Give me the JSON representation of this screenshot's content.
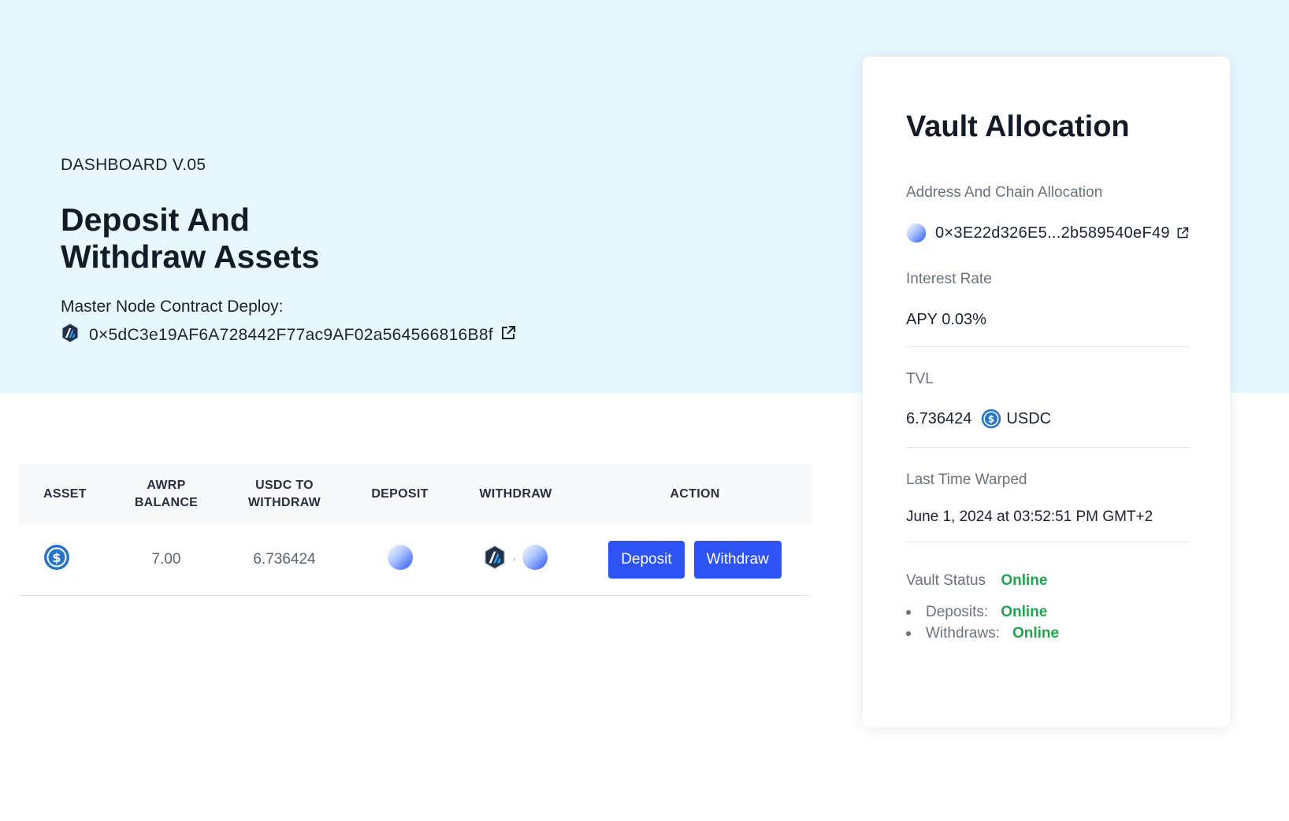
{
  "hero": {
    "eyebrow": "DASHBOARD V.05",
    "title": "Deposit And Withdraw Assets",
    "contract_label": "Master Node Contract Deploy:",
    "contract_address": "0×5dC3e19AF6A728442F77ac9AF02a564566816B8f",
    "chain_icon": "arbitrum-icon",
    "link_icon": "external-link-icon"
  },
  "table": {
    "headers": {
      "asset": "ASSET",
      "awrp_balance_1": "AWRP",
      "awrp_balance_2": "BALANCE",
      "usdc_withdraw_1": "USDC TO",
      "usdc_withdraw_2": "WITHDRAW",
      "deposit": "DEPOSIT",
      "withdraw": "WITHDRAW",
      "action": "ACTION"
    },
    "rows": [
      {
        "asset_icon": "usdc-icon",
        "awrp_balance": "7.00",
        "usdc_to_withdraw": "6.736424",
        "deposit_icon": "chain-icon",
        "withdraw_from_icon": "arbitrum-icon",
        "withdraw_arrow": "›",
        "withdraw_to_icon": "chain-icon",
        "deposit_label": "Deposit",
        "withdraw_label": "Withdraw"
      }
    ]
  },
  "vault": {
    "title": "Vault Allocation",
    "address_label": "Address And Chain Allocation",
    "address": "0×3E22d326E5...2b589540eF49",
    "interest_label": "Interest Rate",
    "apy": "APY 0.03%",
    "tvl_label": "TVL",
    "tvl_value": "6.736424",
    "tvl_token": "USDC",
    "last_warp_label": "Last Time Warped",
    "last_warp_value": "June 1, 2024 at 03:52:51 PM GMT+2",
    "status_label": "Vault Status",
    "status_value": "Online",
    "deposits_label": "Deposits:",
    "deposits_value": "Online",
    "withdraws_label": "Withdraws:",
    "withdraws_value": "Online"
  },
  "colors": {
    "hero_bg": "#e8f7fe",
    "accent_button": "#2e53f5",
    "online": "#1fa64a",
    "usdc": "#2775ca"
  }
}
